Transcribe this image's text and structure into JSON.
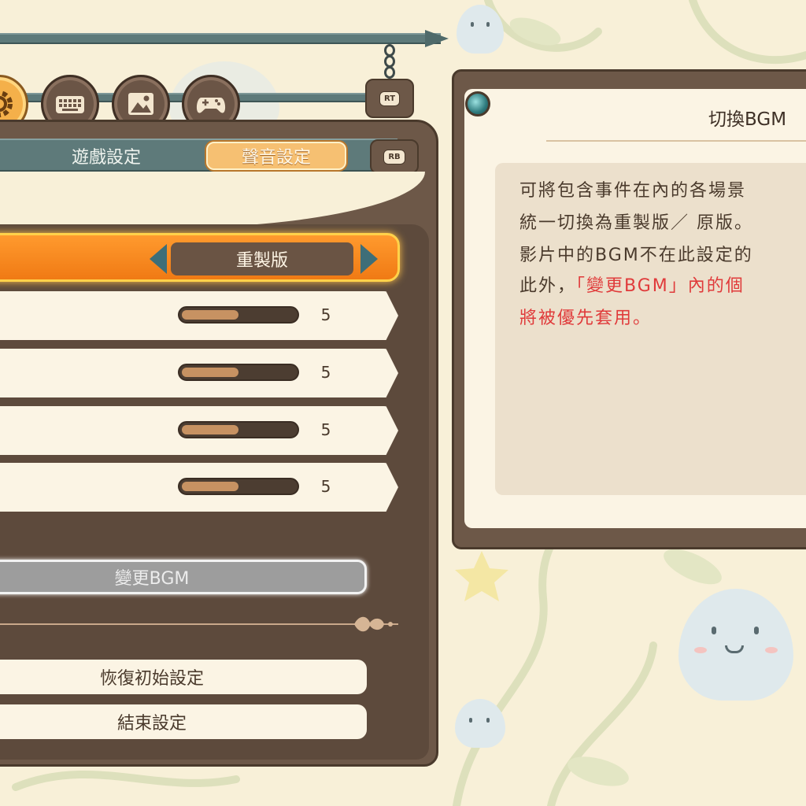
{
  "tabs": {
    "game_settings": "遊戲設定",
    "sound_settings": "聲音設定",
    "rb_label": "RB",
    "rt_label": "RT"
  },
  "category_icons": [
    "gear-icon",
    "keyboard-icon",
    "image-icon",
    "gamepad-icon"
  ],
  "settings": {
    "bgm_version": {
      "value": "重製版"
    },
    "volume_rows": [
      {
        "value": "5",
        "level": 0.5
      },
      {
        "value": "5",
        "level": 0.5
      },
      {
        "value": "5",
        "level": 0.5
      },
      {
        "value": "5",
        "level": 0.5
      }
    ]
  },
  "buttons": {
    "change_bgm": "變更BGM",
    "reset_defaults": "恢復初始設定",
    "end_settings": "結束設定"
  },
  "help": {
    "title": "切換BGM",
    "lines": [
      {
        "text": "可將包含事件在內的各場景",
        "red": false
      },
      {
        "text": "統一切換為重製版／ 原版。",
        "red": false
      },
      {
        "text": "影片中的BGM不在此設定的",
        "red": false
      },
      {
        "text_prefix": "此外，",
        "text_red": "「變更BGM」內的個",
        "red": true
      },
      {
        "text": "將被優先套用。",
        "red": true
      }
    ]
  },
  "colors": {
    "accent_orange": "#f07a14",
    "panel_brown": "#6d5848",
    "cream": "#fbf4e4",
    "teal_rail": "#5e7a7a",
    "warning_red": "#e03a3a"
  }
}
